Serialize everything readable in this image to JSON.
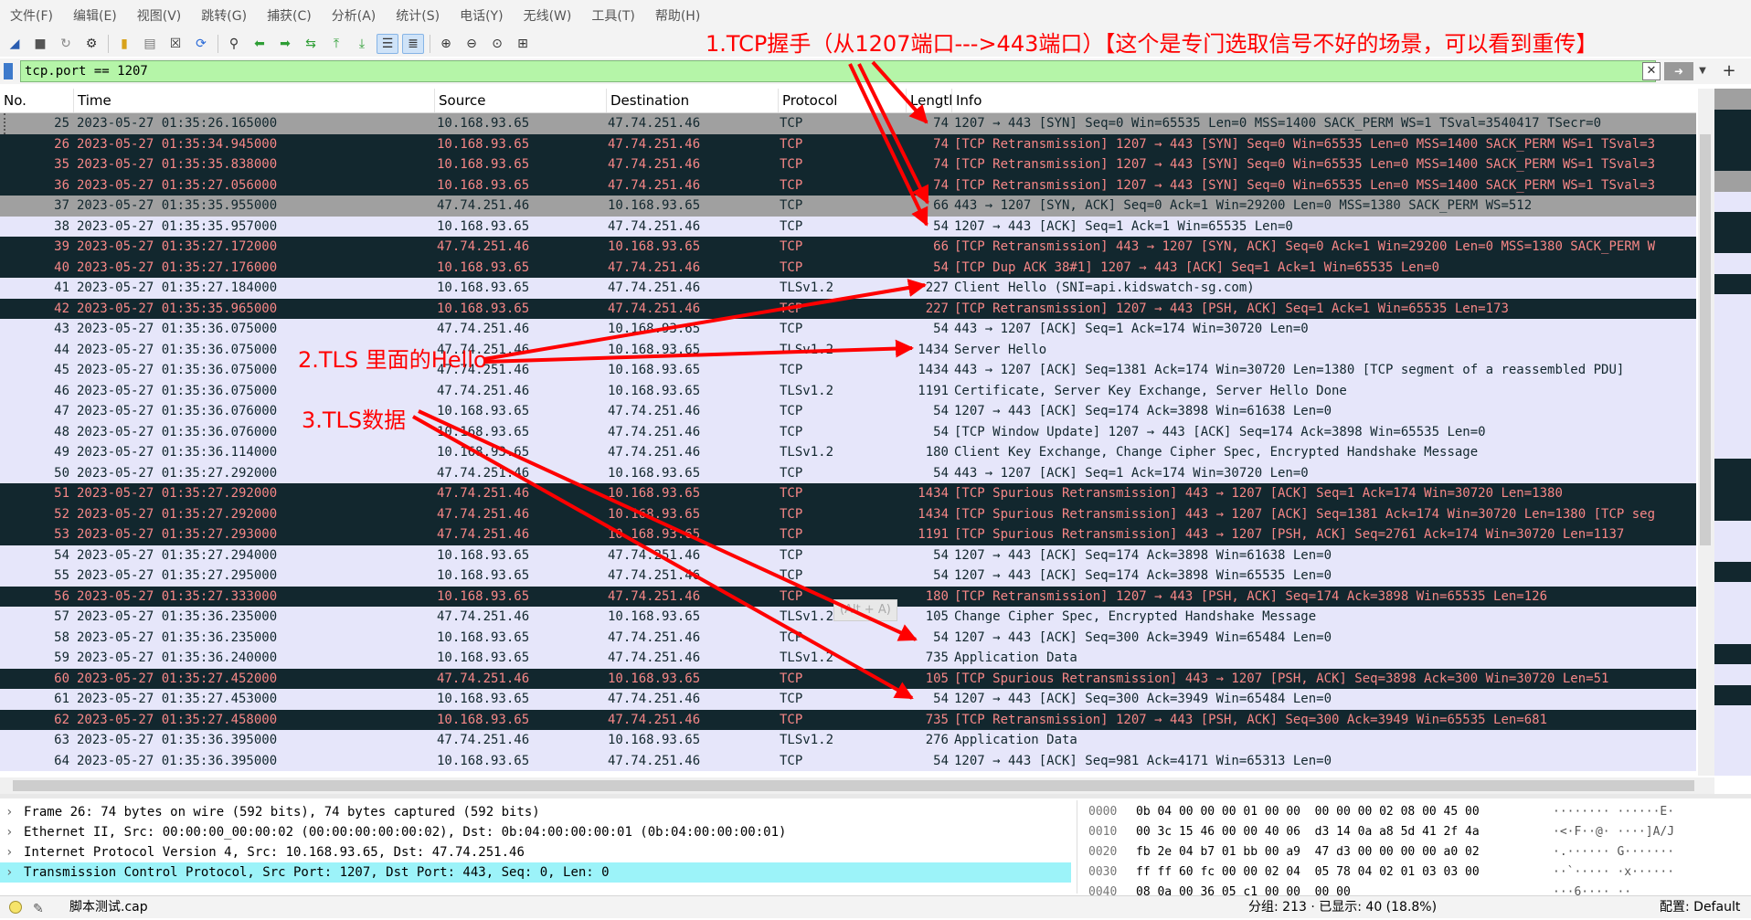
{
  "menu": [
    "文件(F)",
    "编辑(E)",
    "视图(V)",
    "跳转(G)",
    "捕获(C)",
    "分析(A)",
    "统计(S)",
    "电话(Y)",
    "无线(W)",
    "工具(T)",
    "帮助(H)"
  ],
  "filter": {
    "value": "tcp.port == 1207"
  },
  "columns": {
    "no": "No.",
    "time": "Time",
    "source": "Source",
    "destination": "Destination",
    "protocol": "Protocol",
    "length": "Lengtl",
    "info": "Info"
  },
  "packets": [
    {
      "no": "25",
      "time": "2023-05-27 01:35:26.165000",
      "src": "10.168.93.65",
      "dst": "47.74.251.46",
      "proto": "TCP",
      "len": "74",
      "info": "1207 → 443 [SYN] Seq=0 Win=65535 Len=0 MSS=1400 SACK_PERM WS=1 TSval=3540417 TSecr=0",
      "style": "sel"
    },
    {
      "no": "26",
      "time": "2023-05-27 01:35:34.945000",
      "src": "10.168.93.65",
      "dst": "47.74.251.46",
      "proto": "TCP",
      "len": "74",
      "info": "[TCP Retransmission] 1207 → 443 [SYN] Seq=0 Win=65535 Len=0 MSS=1400 SACK_PERM WS=1 TSval=3",
      "style": "bad"
    },
    {
      "no": "35",
      "time": "2023-05-27 01:35:35.838000",
      "src": "10.168.93.65",
      "dst": "47.74.251.46",
      "proto": "TCP",
      "len": "74",
      "info": "[TCP Retransmission] 1207 → 443 [SYN] Seq=0 Win=65535 Len=0 MSS=1400 SACK_PERM WS=1 TSval=3",
      "style": "bad"
    },
    {
      "no": "36",
      "time": "2023-05-27 01:35:27.056000",
      "src": "10.168.93.65",
      "dst": "47.74.251.46",
      "proto": "TCP",
      "len": "74",
      "info": "[TCP Retransmission] 1207 → 443 [SYN] Seq=0 Win=65535 Len=0 MSS=1400 SACK_PERM WS=1 TSval=3",
      "style": "bad"
    },
    {
      "no": "37",
      "time": "2023-05-27 01:35:35.955000",
      "src": "47.74.251.46",
      "dst": "10.168.93.65",
      "proto": "TCP",
      "len": "66",
      "info": "443 → 1207 [SYN, ACK] Seq=0 Ack=1 Win=29200 Len=0 MSS=1380 SACK_PERM WS=512",
      "style": "sel"
    },
    {
      "no": "38",
      "time": "2023-05-27 01:35:35.957000",
      "src": "10.168.93.65",
      "dst": "47.74.251.46",
      "proto": "TCP",
      "len": "54",
      "info": "1207 → 443 [ACK] Seq=1 Ack=1 Win=65535 Len=0",
      "style": "normal"
    },
    {
      "no": "39",
      "time": "2023-05-27 01:35:27.172000",
      "src": "47.74.251.46",
      "dst": "10.168.93.65",
      "proto": "TCP",
      "len": "66",
      "info": "[TCP Retransmission] 443 → 1207 [SYN, ACK] Seq=0 Ack=1 Win=29200 Len=0 MSS=1380 SACK_PERM W",
      "style": "bad"
    },
    {
      "no": "40",
      "time": "2023-05-27 01:35:27.176000",
      "src": "10.168.93.65",
      "dst": "47.74.251.46",
      "proto": "TCP",
      "len": "54",
      "info": "[TCP Dup ACK 38#1] 1207 → 443 [ACK] Seq=1 Ack=1 Win=65535 Len=0",
      "style": "bad"
    },
    {
      "no": "41",
      "time": "2023-05-27 01:35:27.184000",
      "src": "10.168.93.65",
      "dst": "47.74.251.46",
      "proto": "TLSv1.2",
      "len": "227",
      "info": "Client Hello (SNI=api.kidswatch-sg.com)",
      "style": "normal"
    },
    {
      "no": "42",
      "time": "2023-05-27 01:35:35.965000",
      "src": "10.168.93.65",
      "dst": "47.74.251.46",
      "proto": "TCP",
      "len": "227",
      "info": "[TCP Retransmission] 1207 → 443 [PSH, ACK] Seq=1 Ack=1 Win=65535 Len=173",
      "style": "bad"
    },
    {
      "no": "43",
      "time": "2023-05-27 01:35:36.075000",
      "src": "47.74.251.46",
      "dst": "10.168.93.65",
      "proto": "TCP",
      "len": "54",
      "info": "443 → 1207 [ACK] Seq=1 Ack=174 Win=30720 Len=0",
      "style": "normal"
    },
    {
      "no": "44",
      "time": "2023-05-27 01:35:36.075000",
      "src": "47.74.251.46",
      "dst": "10.168.93.65",
      "proto": "TLSv1.2",
      "len": "1434",
      "info": "Server Hello",
      "style": "normal"
    },
    {
      "no": "45",
      "time": "2023-05-27 01:35:36.075000",
      "src": "47.74.251.46",
      "dst": "10.168.93.65",
      "proto": "TCP",
      "len": "1434",
      "info": "443 → 1207 [ACK] Seq=1381 Ack=174 Win=30720 Len=1380 [TCP segment of a reassembled PDU]",
      "style": "normal"
    },
    {
      "no": "46",
      "time": "2023-05-27 01:35:36.075000",
      "src": "47.74.251.46",
      "dst": "10.168.93.65",
      "proto": "TLSv1.2",
      "len": "1191",
      "info": "Certificate, Server Key Exchange, Server Hello Done",
      "style": "normal"
    },
    {
      "no": "47",
      "time": "2023-05-27 01:35:36.076000",
      "src": "10.168.93.65",
      "dst": "47.74.251.46",
      "proto": "TCP",
      "len": "54",
      "info": "1207 → 443 [ACK] Seq=174 Ack=3898 Win=61638 Len=0",
      "style": "normal"
    },
    {
      "no": "48",
      "time": "2023-05-27 01:35:36.076000",
      "src": "10.168.93.65",
      "dst": "47.74.251.46",
      "proto": "TCP",
      "len": "54",
      "info": "[TCP Window Update] 1207 → 443 [ACK] Seq=174 Ack=3898 Win=65535 Len=0",
      "style": "normal"
    },
    {
      "no": "49",
      "time": "2023-05-27 01:35:36.114000",
      "src": "10.168.93.65",
      "dst": "47.74.251.46",
      "proto": "TLSv1.2",
      "len": "180",
      "info": "Client Key Exchange, Change Cipher Spec, Encrypted Handshake Message",
      "style": "normal"
    },
    {
      "no": "50",
      "time": "2023-05-27 01:35:27.292000",
      "src": "47.74.251.46",
      "dst": "10.168.93.65",
      "proto": "TCP",
      "len": "54",
      "info": "443 → 1207 [ACK] Seq=1 Ack=174 Win=30720 Len=0",
      "style": "normal"
    },
    {
      "no": "51",
      "time": "2023-05-27 01:35:27.292000",
      "src": "47.74.251.46",
      "dst": "10.168.93.65",
      "proto": "TCP",
      "len": "1434",
      "info": "[TCP Spurious Retransmission] 443 → 1207 [ACK] Seq=1 Ack=174 Win=30720 Len=1380",
      "style": "bad"
    },
    {
      "no": "52",
      "time": "2023-05-27 01:35:27.292000",
      "src": "47.74.251.46",
      "dst": "10.168.93.65",
      "proto": "TCP",
      "len": "1434",
      "info": "[TCP Spurious Retransmission] 443 → 1207 [ACK] Seq=1381 Ack=174 Win=30720 Len=1380 [TCP seg",
      "style": "bad"
    },
    {
      "no": "53",
      "time": "2023-05-27 01:35:27.293000",
      "src": "47.74.251.46",
      "dst": "10.168.93.65",
      "proto": "TCP",
      "len": "1191",
      "info": "[TCP Spurious Retransmission] 443 → 1207 [PSH, ACK] Seq=2761 Ack=174 Win=30720 Len=1137",
      "style": "bad"
    },
    {
      "no": "54",
      "time": "2023-05-27 01:35:27.294000",
      "src": "10.168.93.65",
      "dst": "47.74.251.46",
      "proto": "TCP",
      "len": "54",
      "info": "1207 → 443 [ACK] Seq=174 Ack=3898 Win=61638 Len=0",
      "style": "normal"
    },
    {
      "no": "55",
      "time": "2023-05-27 01:35:27.295000",
      "src": "10.168.93.65",
      "dst": "47.74.251.46",
      "proto": "TCP",
      "len": "54",
      "info": "1207 → 443 [ACK] Seq=174 Ack=3898 Win=65535 Len=0",
      "style": "normal"
    },
    {
      "no": "56",
      "time": "2023-05-27 01:35:27.333000",
      "src": "10.168.93.65",
      "dst": "47.74.251.46",
      "proto": "TCP",
      "len": "180",
      "info": "[TCP Retransmission] 1207 → 443 [PSH, ACK] Seq=174 Ack=3898 Win=65535 Len=126",
      "style": "bad"
    },
    {
      "no": "57",
      "time": "2023-05-27 01:35:36.235000",
      "src": "47.74.251.46",
      "dst": "10.168.93.65",
      "proto": "TLSv1.2",
      "len": "105",
      "info": "Change Cipher Spec, Encrypted Handshake Message",
      "style": "normal"
    },
    {
      "no": "58",
      "time": "2023-05-27 01:35:36.235000",
      "src": "10.168.93.65",
      "dst": "47.74.251.46",
      "proto": "TCP",
      "len": "54",
      "info": "1207 → 443 [ACK] Seq=300 Ack=3949 Win=65484 Len=0",
      "style": "normal"
    },
    {
      "no": "59",
      "time": "2023-05-27 01:35:36.240000",
      "src": "10.168.93.65",
      "dst": "47.74.251.46",
      "proto": "TLSv1.2",
      "len": "735",
      "info": "Application Data",
      "style": "normal"
    },
    {
      "no": "60",
      "time": "2023-05-27 01:35:27.452000",
      "src": "47.74.251.46",
      "dst": "10.168.93.65",
      "proto": "TCP",
      "len": "105",
      "info": "[TCP Spurious Retransmission] 443 → 1207 [PSH, ACK] Seq=3898 Ack=300 Win=30720 Len=51",
      "style": "bad"
    },
    {
      "no": "61",
      "time": "2023-05-27 01:35:27.453000",
      "src": "10.168.93.65",
      "dst": "47.74.251.46",
      "proto": "TCP",
      "len": "54",
      "info": "1207 → 443 [ACK] Seq=300 Ack=3949 Win=65484 Len=0",
      "style": "normal"
    },
    {
      "no": "62",
      "time": "2023-05-27 01:35:27.458000",
      "src": "10.168.93.65",
      "dst": "47.74.251.46",
      "proto": "TCP",
      "len": "735",
      "info": "[TCP Retransmission] 1207 → 443 [PSH, ACK] Seq=300 Ack=3949 Win=65535 Len=681",
      "style": "bad"
    },
    {
      "no": "63",
      "time": "2023-05-27 01:35:36.395000",
      "src": "47.74.251.46",
      "dst": "10.168.93.65",
      "proto": "TLSv1.2",
      "len": "276",
      "info": "Application Data",
      "style": "normal"
    },
    {
      "no": "64",
      "time": "2023-05-27 01:35:36.395000",
      "src": "10.168.93.65",
      "dst": "47.74.251.46",
      "proto": "TCP",
      "len": "54",
      "info": "1207 → 443 [ACK] Seq=981 Ack=4171 Win=65313 Len=0",
      "style": "normal"
    }
  ],
  "details": [
    "Frame 26: 74 bytes on wire (592 bits), 74 bytes captured (592 bits)",
    "Ethernet II, Src: 00:00:00_00:00:02 (00:00:00:00:00:02), Dst: 0b:04:00:00:00:01 (0b:04:00:00:00:01)",
    "Internet Protocol Version 4, Src: 10.168.93.65, Dst: 47.74.251.46",
    "Transmission Control Protocol, Src Port: 1207, Dst Port: 443, Seq: 0, Len: 0"
  ],
  "bytes": [
    {
      "off": "0000",
      "hex": "0b 04 00 00 00 01 00 00  00 00 00 02 08 00 45 00",
      "ascii": "········ ······E·"
    },
    {
      "off": "0010",
      "hex": "00 3c 15 46 00 00 40 06  d3 14 0a a8 5d 41 2f 4a",
      "ascii": "·<·F··@· ····]A/J"
    },
    {
      "off": "0020",
      "hex": "fb 2e 04 b7 01 bb 00 a9  47 d3 00 00 00 00 a0 02",
      "ascii": "·.······ G·······"
    },
    {
      "off": "0030",
      "hex": "ff ff 60 fc 00 00 02 04  05 78 04 02 01 03 03 00",
      "ascii": "··`····· ·x······"
    },
    {
      "off": "0040",
      "hex": "08 0a 00 36 05 c1 00 00  00 00",
      "ascii": "···6···· ··"
    }
  ],
  "status": {
    "file": "脚本测试.cap",
    "counts": "分组: 213 · 已显示: 40 (18.8%)",
    "profile": "配置: Default"
  },
  "annotations": {
    "tcp": "1.TCP握手（从1207端口--->443端口）【这个是专门选取信号不好的场景，可以看到重传】",
    "hello": "2.TLS 里面的Hello",
    "data": "3.TLS数据"
  },
  "tooltip": "(Alt + A)",
  "colors": {
    "normal_row_bg": "#e6e6fa",
    "selected_row_bg": "#a0a0a0",
    "bad_row_bg": "#12272e",
    "bad_row_fg": "#f78787",
    "filter_bg": "#b5f5a8",
    "annotation": "#ff0000",
    "detail_highlight": "#9cf3f9"
  },
  "icons": [
    "shark-fin-start-icon",
    "stop-icon",
    "restart-icon",
    "options-gear-icon",
    "open-file-icon",
    "save-file-icon",
    "close-file-icon",
    "reload-icon",
    "find-icon",
    "back-icon",
    "forward-icon",
    "go-to-packet-icon",
    "first-packet-icon",
    "last-packet-icon",
    "autoscroll-icon",
    "colorize-icon",
    "zoom-in-icon",
    "zoom-out-icon",
    "zoom-reset-icon",
    "resize-columns-icon"
  ]
}
